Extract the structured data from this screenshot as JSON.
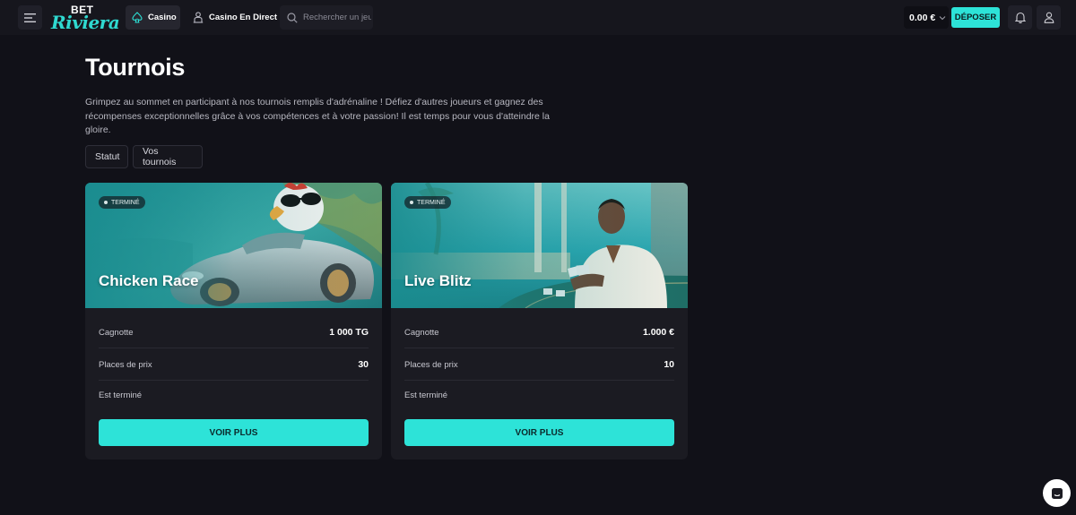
{
  "header": {
    "logo_top": "BET",
    "logo_bottom": "Riviera",
    "nav": [
      {
        "label": "Casino",
        "icon": "spade-icon"
      },
      {
        "label": "Casino En Direct",
        "icon": "dealer-icon"
      }
    ],
    "search_placeholder": "Rechercher un jeu",
    "balance": "0.00 €",
    "deposit_label": "DÉPOSER"
  },
  "page": {
    "title": "Tournois",
    "description": "Grimpez au sommet en participant à nos tournois remplis d'adrénaline ! Défiez d'autres joueurs et gagnez des récompenses exceptionnelles grâce à vos compétences et à votre passion! Il est temps pour vous d'atteindre la gloire."
  },
  "filters": [
    "Statut",
    "Vos tournois"
  ],
  "tournaments": [
    {
      "status": "TERMINÉ",
      "title": "Chicken Race",
      "prize_label": "Cagnotte",
      "prize_value": "1 000 TG",
      "places_label": "Places de prix",
      "places_value": "30",
      "ended_label": "Est terminé",
      "button": "VOIR PLUS"
    },
    {
      "status": "TERMINÉ",
      "title": "Live Blitz",
      "prize_label": "Cagnotte",
      "prize_value": "1.000 €",
      "places_label": "Places de prix",
      "places_value": "10",
      "ended_label": "Est terminé",
      "button": "VOIR PLUS"
    }
  ],
  "colors": {
    "accent": "#2de3d8",
    "background": "#111118",
    "card": "#1b1b22"
  }
}
